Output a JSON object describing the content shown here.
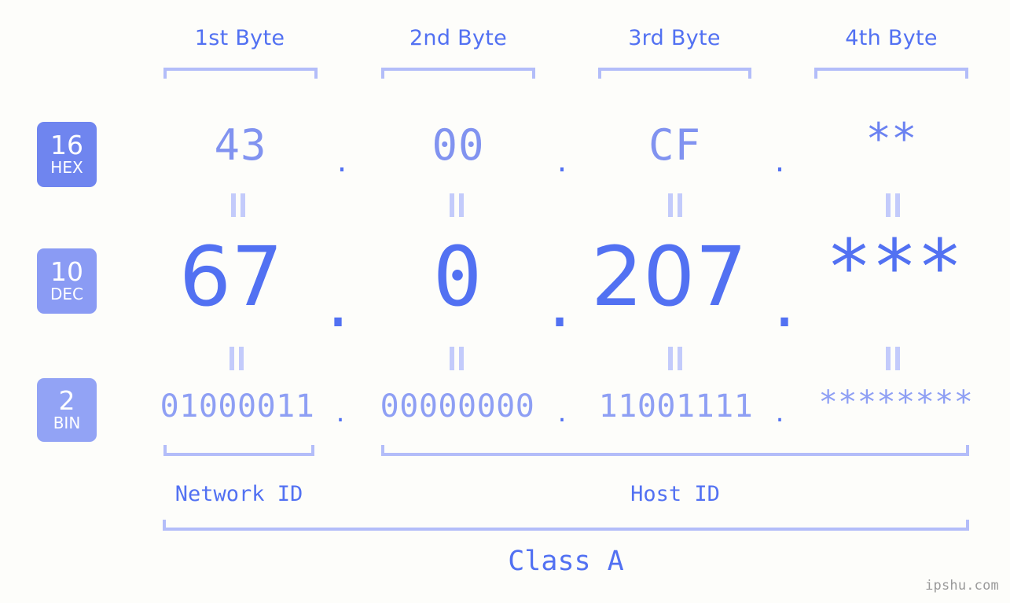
{
  "meta": {
    "background_color": "#fdfdfa",
    "accent_strong": "#5271f2",
    "accent_mid": "#8193f0",
    "accent_light": "#b3bdf9",
    "badge_text_color": "#ffffff"
  },
  "headers": {
    "bytes": [
      {
        "label": "1st Byte"
      },
      {
        "label": "2nd Byte"
      },
      {
        "label": "3rd Byte"
      },
      {
        "label": "4th Byte"
      }
    ]
  },
  "badges": [
    {
      "num": "16",
      "abbr": "HEX",
      "color": "#6f85ef"
    },
    {
      "num": "10",
      "abbr": "DEC",
      "color": "#8a9bf4"
    },
    {
      "num": "2",
      "abbr": "BIN",
      "color": "#92a3f5"
    }
  ],
  "rows": {
    "hex": {
      "radix": "16",
      "name": "HEX",
      "octets": [
        "43",
        "00",
        "CF",
        "**"
      ]
    },
    "dec": {
      "radix": "10",
      "name": "DEC",
      "octets": [
        "67",
        "0",
        "207",
        "***"
      ]
    },
    "bin": {
      "radix": "2",
      "name": "BIN",
      "octets": [
        "01000011",
        "00000000",
        "11001111",
        "********"
      ]
    }
  },
  "separators": {
    "dot": ".",
    "equals": "="
  },
  "sections": {
    "network_id": "Network ID",
    "host_id": "Host ID",
    "class": "Class A"
  },
  "watermark": "ipshu.com"
}
